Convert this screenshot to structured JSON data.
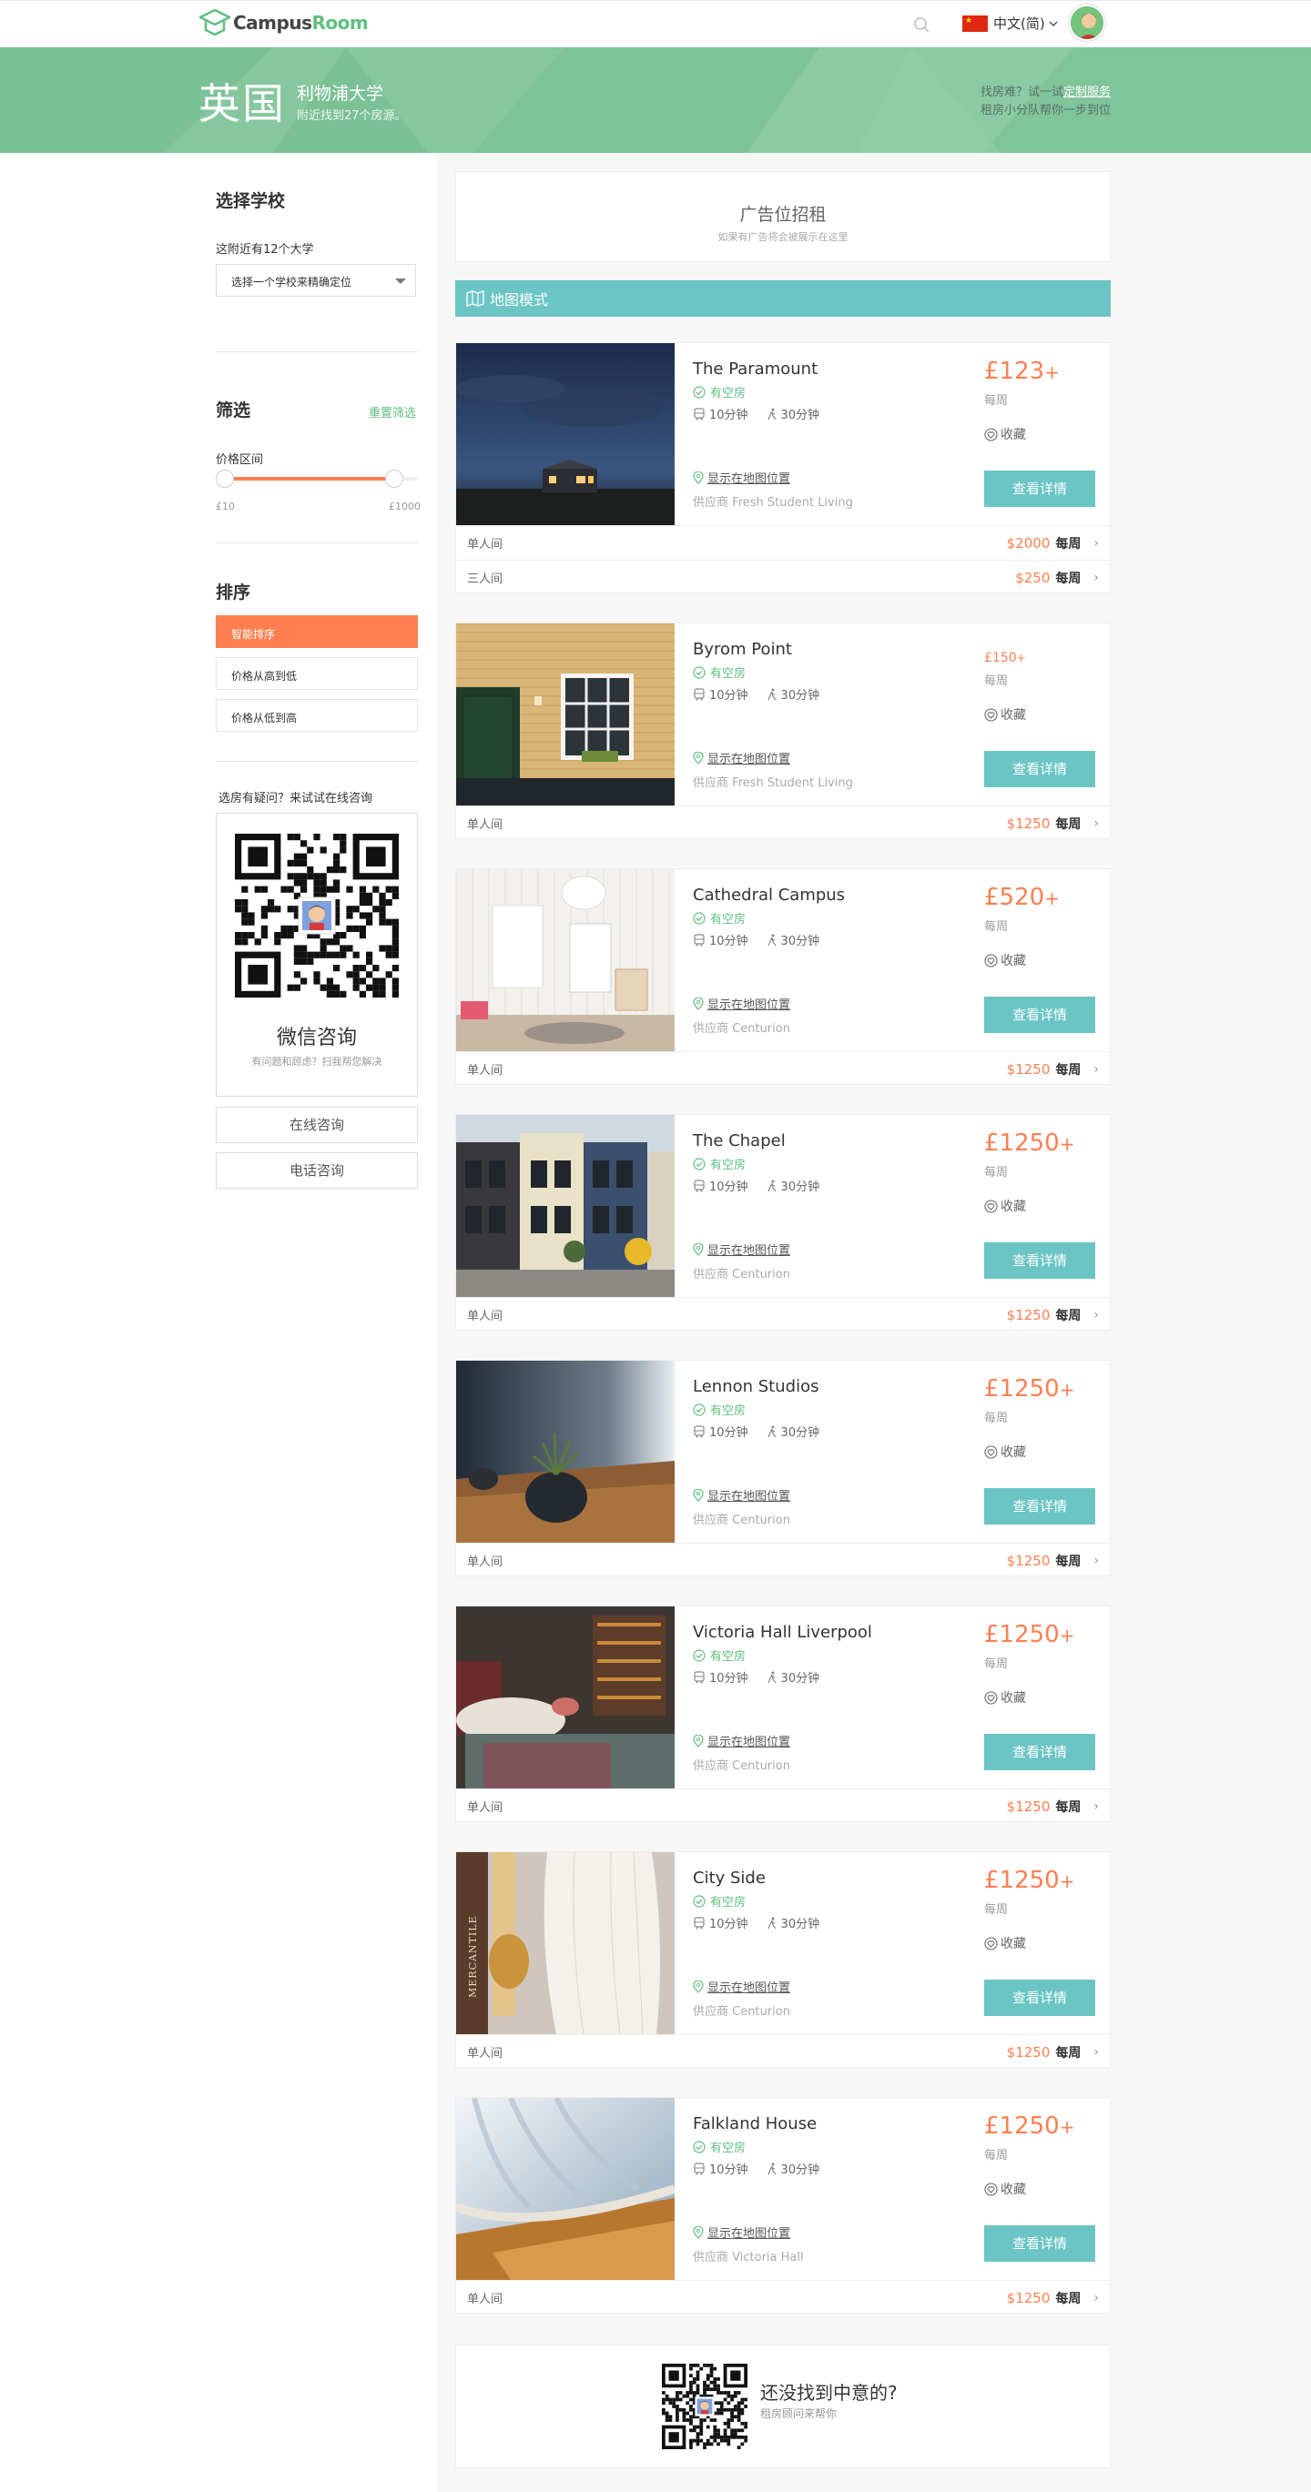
{
  "header": {
    "logo_prefix": "Campus",
    "logo_suffix": "Room",
    "language": "中文(简)",
    "colors": {
      "brand_green": "#5fbf7f",
      "accent_orange": "#ff7f50",
      "teal": "#6ac5c4"
    }
  },
  "hero": {
    "country": "英国",
    "university": "利物浦大学",
    "found_text": "附近找到27个房源。",
    "right_line1_prefix": "找房难？试一试",
    "right_line1_link": "定制服务",
    "right_line2": "租房小分队帮你一步到位"
  },
  "sidebar": {
    "school_title": "选择学校",
    "nearby_count": "这附近有12个大学",
    "school_select_placeholder": "选择一个学校来精确定位",
    "filter_title": "筛选",
    "reset_filter": "重置筛选",
    "price_range_label": "价格区间",
    "price_min": "£10",
    "price_max": "£1000",
    "sort_title": "排序",
    "sort_options": [
      "智能排序",
      "价格从高到低",
      "价格从低到高"
    ],
    "consult_question": "选房有疑问？来试试在线咨询",
    "wechat_title": "微信咨询",
    "wechat_sub": "有问题和顾虑？扫我帮您解决",
    "online_consult": "在线咨询",
    "phone_consult": "电话咨询"
  },
  "ad": {
    "title": "广告位招租",
    "sub": "如果有广告将会被展示在这里"
  },
  "map_mode": "地图模式",
  "common": {
    "available": "有空房",
    "bus_time": "10分钟",
    "walk_time": "30分钟",
    "show_on_map": "显示在地图位置",
    "per_week": "每周",
    "favorite": "收藏",
    "view_details": "查看详情",
    "supplier_prefix": "供应商"
  },
  "listings": [
    {
      "name": "The Paramount",
      "price": "£123",
      "plus": "+",
      "supplier": "Fresh Student Living",
      "img": "night",
      "rooms": [
        {
          "type": "单人间",
          "price": "$2000",
          "period": "每周"
        },
        {
          "type": "三人间",
          "price": "$250",
          "period": "每周"
        }
      ]
    },
    {
      "name": "Byrom Point",
      "price": "£150",
      "plus": "+",
      "small": true,
      "supplier": "Fresh Student Living",
      "img": "brick",
      "rooms": [
        {
          "type": "单人间",
          "price": "$1250",
          "period": "每周"
        }
      ]
    },
    {
      "name": "Cathedral Campus",
      "price": "£520",
      "plus": "+",
      "supplier": "Centurion",
      "img": "room",
      "rooms": [
        {
          "type": "单人间",
          "price": "$1250",
          "period": "每周"
        }
      ]
    },
    {
      "name": "The Chapel",
      "price": "£1250",
      "plus": "+",
      "supplier": "Centurion",
      "img": "houses",
      "rooms": [
        {
          "type": "单人间",
          "price": "$1250",
          "period": "每周"
        }
      ]
    },
    {
      "name": "Lennon Studios",
      "price": "£1250",
      "plus": "+",
      "supplier": "Centurion",
      "img": "plant",
      "rooms": [
        {
          "type": "单人间",
          "price": "$1250",
          "period": "每周"
        }
      ]
    },
    {
      "name": "Victoria Hall Liverpool",
      "price": "£1250",
      "plus": "+",
      "supplier": "Centurion",
      "img": "living",
      "rooms": [
        {
          "type": "单人间",
          "price": "$1250",
          "period": "每周"
        }
      ]
    },
    {
      "name": "City Side",
      "price": "£1250",
      "plus": "+",
      "supplier": "Centurion",
      "img": "closet",
      "rooms": [
        {
          "type": "单人间",
          "price": "$1250",
          "period": "每周"
        }
      ]
    },
    {
      "name": "Falkland House",
      "price": "£1250",
      "plus": "+",
      "supplier": "Victoria Hall",
      "img": "curtain",
      "rooms": [
        {
          "type": "单人间",
          "price": "$1250",
          "period": "每周"
        }
      ]
    }
  ],
  "bottom": {
    "title": "还没找到中意的?",
    "sub": "租房顾问来帮你"
  },
  "closet_text": "MERCANTILE"
}
